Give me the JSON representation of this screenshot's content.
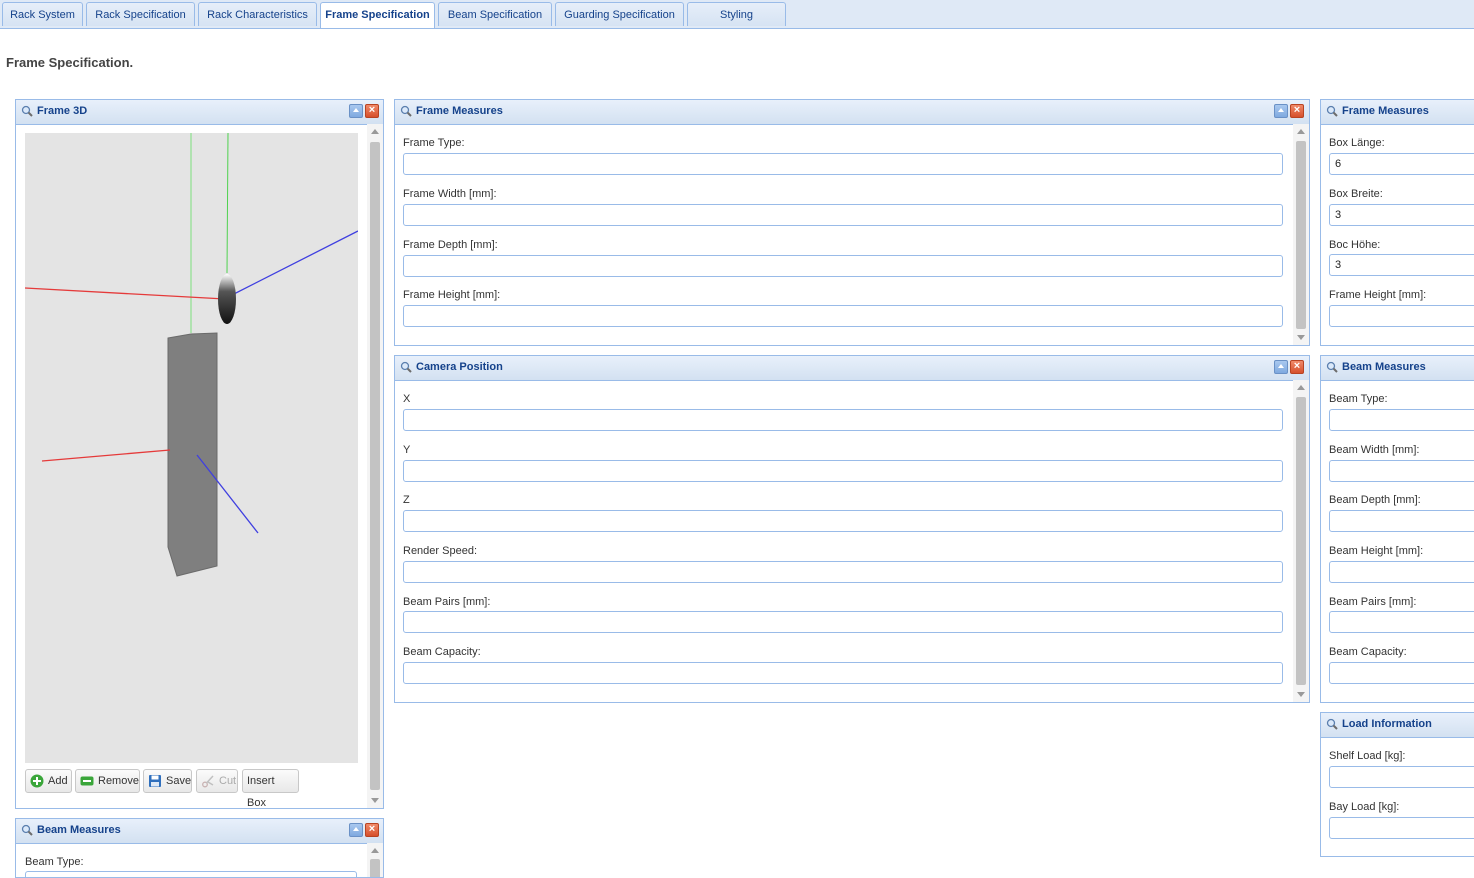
{
  "tabs": [
    "Rack System",
    "Rack Specification",
    "Rack Characteristics",
    "Frame Specification",
    "Beam Specification",
    "Guarding Specification",
    "Styling"
  ],
  "page_title": "Frame Specification.",
  "frame3d": {
    "title": "Frame 3D",
    "buttons": {
      "add": "Add",
      "remove": "Remove",
      "save": "Save",
      "cut": "Cut",
      "insert_box": "Insert Box"
    }
  },
  "beam_measures_left": {
    "title": "Beam Measures",
    "beam_type": "Beam Type:"
  },
  "frame_measures": {
    "title": "Frame Measures",
    "fields": [
      {
        "label": "Frame Type:",
        "value": ""
      },
      {
        "label": "Frame Width [mm]:",
        "value": ""
      },
      {
        "label": "Frame Depth [mm]:",
        "value": ""
      },
      {
        "label": "Frame Height [mm]:",
        "value": ""
      }
    ]
  },
  "camera_position": {
    "title": "Camera Position",
    "fields": [
      {
        "label": "X",
        "value": ""
      },
      {
        "label": "Y",
        "value": ""
      },
      {
        "label": "Z",
        "value": ""
      },
      {
        "label": "Render Speed:",
        "value": ""
      },
      {
        "label": "Beam Pairs [mm]:",
        "value": ""
      },
      {
        "label": "Beam Capacity:",
        "value": ""
      }
    ]
  },
  "frame_measures_right": {
    "title": "Frame Measures",
    "fields": [
      {
        "label": "Box Länge:",
        "value": "6"
      },
      {
        "label": "Box Breite:",
        "value": "3"
      },
      {
        "label": "Boc Höhe:",
        "value": "3"
      },
      {
        "label": "Frame Height [mm]:",
        "value": ""
      }
    ]
  },
  "beam_measures_right": {
    "title": "Beam Measures",
    "fields": [
      {
        "label": "Beam Type:",
        "value": ""
      },
      {
        "label": "Beam Width [mm]:",
        "value": ""
      },
      {
        "label": "Beam Depth [mm]:",
        "value": ""
      },
      {
        "label": "Beam Height [mm]:",
        "value": ""
      },
      {
        "label": "Beam Pairs [mm]:",
        "value": ""
      },
      {
        "label": "Beam Capacity:",
        "value": ""
      }
    ]
  },
  "load_information": {
    "title": "Load Information",
    "fields": [
      {
        "label": "Shelf Load [kg]:",
        "value": ""
      },
      {
        "label": "Bay Load [kg]:",
        "value": ""
      }
    ]
  },
  "colors": {
    "accent": "#15428b",
    "border": "#99bbe8",
    "header": "#d3e1f1"
  }
}
